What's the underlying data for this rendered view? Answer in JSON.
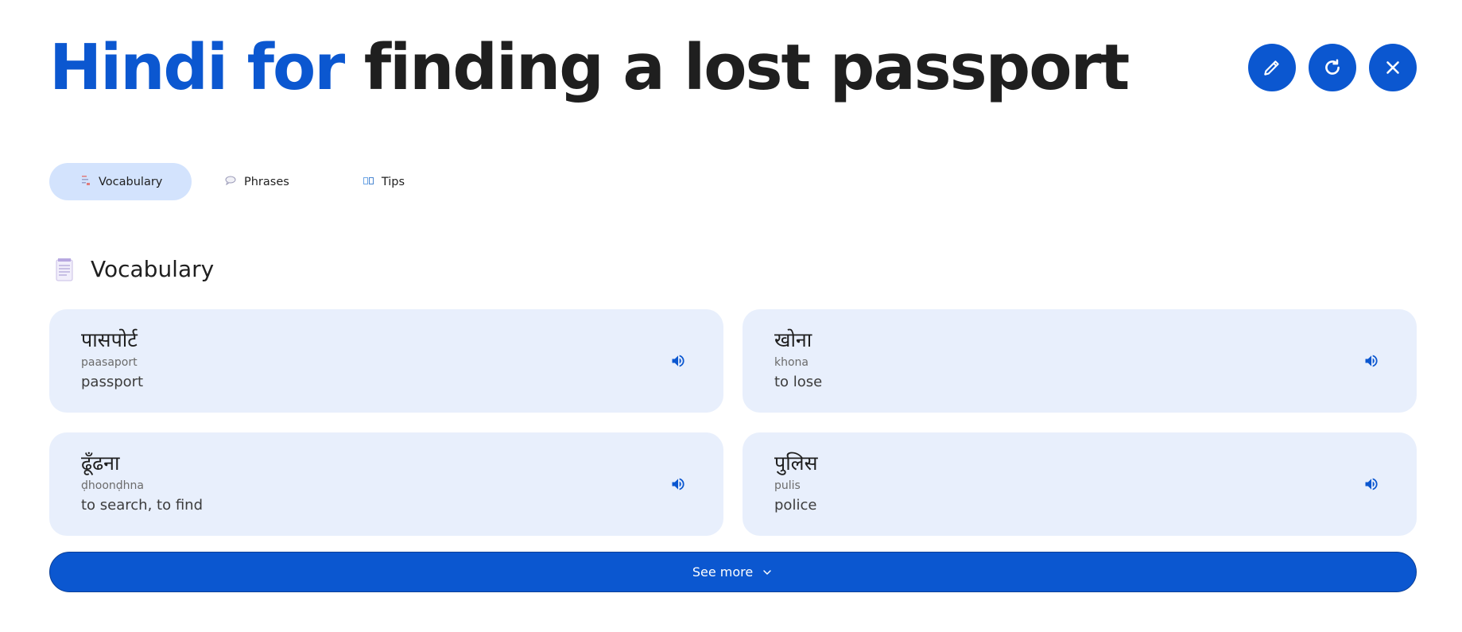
{
  "header": {
    "title_accent": "Hindi for",
    "title_rest": "finding a lost passport",
    "actions": {
      "edit_icon": "pencil-icon",
      "refresh_icon": "refresh-icon",
      "close_icon": "close-icon"
    }
  },
  "tabs": [
    {
      "label": "Vocabulary",
      "icon": "list-icon",
      "active": true
    },
    {
      "label": "Phrases",
      "icon": "speech-bubble-icon",
      "active": false
    },
    {
      "label": "Tips",
      "icon": "book-icon",
      "active": false
    }
  ],
  "section": {
    "title": "Vocabulary",
    "icon": "notepad-icon"
  },
  "vocabulary": [
    {
      "native": "पासपोर्ट",
      "translit": "paasaport",
      "meaning": "passport"
    },
    {
      "native": "खोना",
      "translit": "khona",
      "meaning": "to lose"
    },
    {
      "native": "ढूँढना",
      "translit": "ḍhoonḍhna",
      "meaning": "to search, to find"
    },
    {
      "native": "पुलिस",
      "translit": "pulis",
      "meaning": "police"
    }
  ],
  "see_more": {
    "label": "See more",
    "icon": "chevron-down-icon"
  },
  "colors": {
    "accent": "#0b57d0",
    "card_bg": "#e8effc",
    "tab_active_bg": "#d3e3fd"
  }
}
